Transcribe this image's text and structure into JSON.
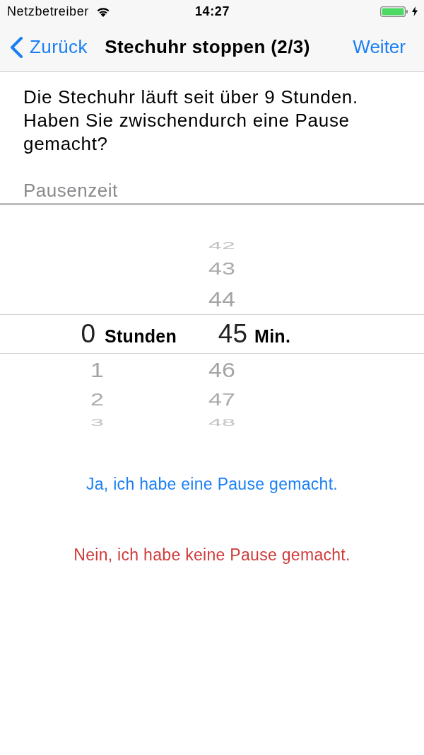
{
  "status_bar": {
    "carrier": "Netzbetreiber",
    "time": "14:27",
    "charging": true
  },
  "nav": {
    "back_label": "Zurück",
    "title": "Stechuhr stoppen (2/3)",
    "next_label": "Weiter"
  },
  "message": "Die Stechuhr läuft seit über 9 Stunden. Haben Sie zwischendurch eine Pause gemacht?",
  "field_label": "Pausenzeit",
  "picker": {
    "columns": [
      {
        "unit": "Stunden",
        "items": [
          {
            "value": "0",
            "selected": true
          },
          {
            "value": "1",
            "selected": false
          },
          {
            "value": "2",
            "selected": false
          },
          {
            "value": "3",
            "selected": false
          }
        ]
      },
      {
        "unit": "Min.",
        "items": [
          {
            "value": "42",
            "selected": false
          },
          {
            "value": "43",
            "selected": false
          },
          {
            "value": "44",
            "selected": false
          },
          {
            "value": "45",
            "selected": true
          },
          {
            "value": "46",
            "selected": false
          },
          {
            "value": "47",
            "selected": false
          },
          {
            "value": "48",
            "selected": false
          }
        ]
      }
    ]
  },
  "actions": [
    {
      "label": "Ja, ich habe eine Pause gemacht.",
      "kind": "confirm"
    },
    {
      "label": "Nein, ich habe keine Pause gemacht.",
      "kind": "decline"
    }
  ]
}
